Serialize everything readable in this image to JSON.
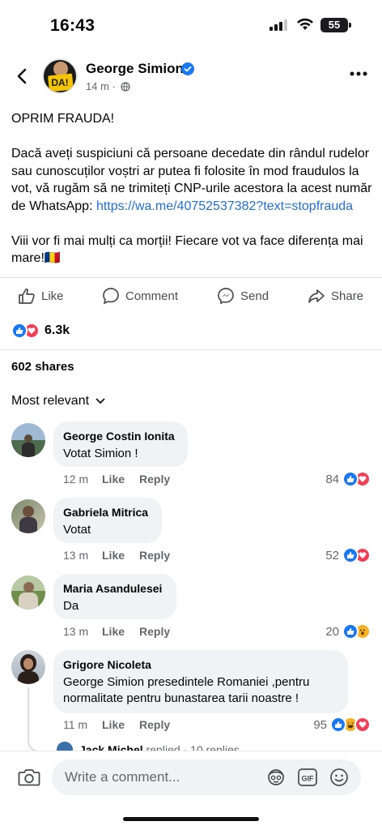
{
  "status_bar": {
    "time": "16:43",
    "battery": "55"
  },
  "post": {
    "author": "George Simion",
    "time": "14 m",
    "paragraph1": "OPRIM FRAUDA!",
    "paragraph2_text": "Dacă aveți suspiciuni că persoane decedate din rândul rudelor sau cunoscuților voștri ar putea fi folosite în mod fraudulos la vot, vă rugăm să ne trimiteți CNP-urile acestora la acest număr de WhatsApp: ",
    "paragraph2_link": "https://wa.me/40752537382?text=stopfrauda",
    "paragraph3": "Viii vor fi mai mulți ca morții! Fiecare vot va face diferența mai mare!🇷🇴",
    "reaction_count": "6.3k",
    "shares": "602 shares"
  },
  "actions": {
    "like": "Like",
    "comment": "Comment",
    "send": "Send",
    "share": "Share"
  },
  "sort_label": "Most relevant",
  "comments": [
    {
      "name": "George Costin Ionita",
      "text": "Votat Simion !",
      "time": "12 m",
      "like": "Like",
      "reply": "Reply",
      "reactions": "84"
    },
    {
      "name": "Gabriela Mitrica",
      "text": "Votat",
      "time": "13 m",
      "like": "Like",
      "reply": "Reply",
      "reactions": "52"
    },
    {
      "name": "Maria Asandulesei",
      "text": "Da",
      "time": "13 m",
      "like": "Like",
      "reply": "Reply",
      "reactions": "20"
    },
    {
      "name": "Grigore Nicoleta",
      "text": "George Simion presedintele Romaniei ,pentru normalitate  pentru bunastarea tarii noastre !",
      "time": "11 m",
      "like": "Like",
      "reply": "Reply",
      "reactions": "95"
    }
  ],
  "reply_preview": {
    "name": "Jack Michel",
    "text": "replied · 10 replies"
  },
  "composer": {
    "placeholder": "Write a comment..."
  },
  "colors": {
    "facebook_blue": "#1877f2",
    "link": "#216fdb",
    "love": "#f33e58",
    "bubble": "#f0f2f5"
  }
}
